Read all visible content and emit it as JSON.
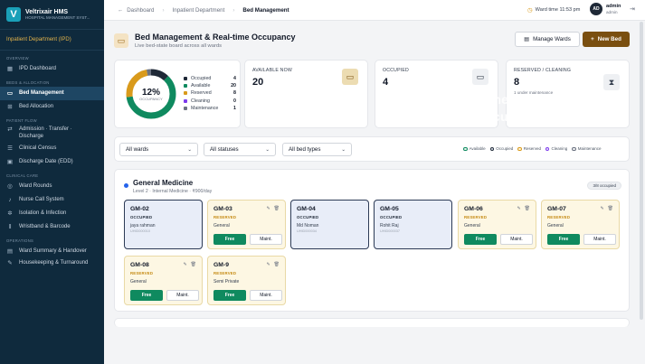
{
  "app": {
    "name": "Veltrixair HMS",
    "subtitle": "HOSPITAL MANAGEMENT SYST..."
  },
  "sidebar": {
    "department": "Inpatient Department (IPD)",
    "sections": {
      "overview": "OVERVIEW",
      "beds": "BEDS & ALLOCATION",
      "flow": "PATIENT FLOW",
      "care": "CLINICAL CARE",
      "ops": "OPERATIONS"
    },
    "items": [
      {
        "label": "IPD Dashboard"
      },
      {
        "label": "Bed Management"
      },
      {
        "label": "Bed Allocation"
      },
      {
        "label": "Admission · Transfer · Discharge"
      },
      {
        "label": "Clinical Census"
      },
      {
        "label": "Discharge Date (EDD)"
      },
      {
        "label": "Ward Rounds"
      },
      {
        "label": "Nurse Call System"
      },
      {
        "label": "Isolation & Infection"
      },
      {
        "label": "Wristband & Barcode"
      },
      {
        "label": "Ward Summary & Handover"
      },
      {
        "label": "Housekeeping & Turnaround"
      }
    ]
  },
  "topbar": {
    "back": "Dashboard",
    "crumb1": "Inpatient Department",
    "crumb2": "Bed Management",
    "ward_time": "Ward time 11:53 pm",
    "avatar": "AD",
    "user_name": "admin",
    "user_role": "admin"
  },
  "header": {
    "title": "Bed Management & Real-time Occupancy",
    "subtitle": "Live bed-state board across all wards",
    "manage_label": "Manage Wards",
    "new_label": "New Bed"
  },
  "occupancy": {
    "percent": "12%",
    "center_label": "OCCUPANCY",
    "legend": [
      {
        "name": "Occupied",
        "value": "4",
        "color": "#1f2937"
      },
      {
        "name": "Available",
        "value": "20",
        "color": "#0f8a5f"
      },
      {
        "name": "Reserved",
        "value": "8",
        "color": "#d99a1b"
      },
      {
        "name": "Cleaning",
        "value": "0",
        "color": "#7c3aed"
      },
      {
        "name": "Maintenance",
        "value": "1",
        "color": "#6b7280"
      }
    ]
  },
  "stats": {
    "available": {
      "title": "AVAILABLE NOW",
      "value": "20"
    },
    "occupied": {
      "title": "OCCUPIED",
      "value": "4"
    },
    "reserved": {
      "title": "RESERVED / CLEANING",
      "value": "8",
      "sub": "1 under maintenance"
    }
  },
  "overlay": {
    "line1": "Bed Management &",
    "line2": "Real-time Occupancy"
  },
  "filters": {
    "ward": "All wards",
    "status": "All statuses",
    "type": "All bed types",
    "legend": [
      "Available",
      "Occupied",
      "Reserved",
      "Cleaning",
      "Maintenance"
    ]
  },
  "ward": {
    "name": "General Medicine",
    "sub": "Level 2 · Internal Medicine · ₹900/day",
    "badge": "3/8 occupied"
  },
  "actions": {
    "free": "Free",
    "maint": "Maint."
  },
  "beds": [
    {
      "code": "GM-02",
      "status": "OCCUPIED",
      "patient": "jaya rahman",
      "pid": "UHID000010"
    },
    {
      "code": "GM-03",
      "status": "RESERVED",
      "patient": "General"
    },
    {
      "code": "GM-04",
      "status": "OCCUPIED",
      "patient": "Md Noman",
      "pid": "UHID000034"
    },
    {
      "code": "GM-05",
      "status": "OCCUPIED",
      "patient": "Rohit Raj",
      "pid": "UHID000037"
    },
    {
      "code": "GM-06",
      "status": "RESERVED",
      "patient": "General"
    },
    {
      "code": "GM-07",
      "status": "RESERVED",
      "patient": "General"
    },
    {
      "code": "GM-08",
      "status": "RESERVED",
      "patient": "General"
    },
    {
      "code": "GM-9",
      "status": "RESERVED",
      "patient": "Semi Private"
    }
  ]
}
